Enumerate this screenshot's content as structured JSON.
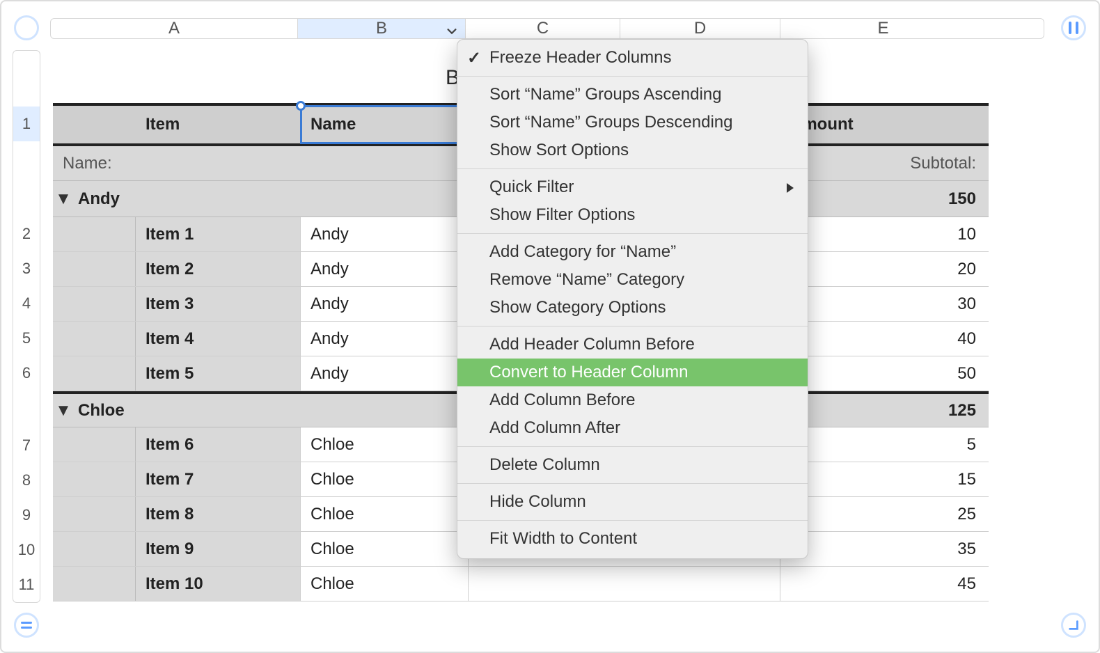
{
  "title_visible": "B",
  "columns": {
    "A": "A",
    "B": "B",
    "C": "C",
    "D": "D",
    "E": "E"
  },
  "rowNumbers": [
    "1",
    "2",
    "3",
    "4",
    "5",
    "6",
    "7",
    "8",
    "9",
    "10",
    "11"
  ],
  "header": {
    "item": "Item",
    "name": "Name",
    "amount": "Amount"
  },
  "groupLabel": {
    "name": "Name:",
    "subtotal": "Subtotal:"
  },
  "groups": [
    {
      "name": "Andy",
      "subtotal": "150",
      "rows": [
        {
          "item": "Item 1",
          "name": "Andy",
          "amount": "10"
        },
        {
          "item": "Item 2",
          "name": "Andy",
          "amount": "20"
        },
        {
          "item": "Item 3",
          "name": "Andy",
          "amount": "30"
        },
        {
          "item": "Item 4",
          "name": "Andy",
          "amount": "40"
        },
        {
          "item": "Item 5",
          "name": "Andy",
          "amount": "50"
        }
      ]
    },
    {
      "name": "Chloe",
      "subtotal": "125",
      "rows": [
        {
          "item": "Item 6",
          "name": "Chloe",
          "amount": "5"
        },
        {
          "item": "Item 7",
          "name": "Chloe",
          "amount": "15"
        },
        {
          "item": "Item 8",
          "name": "Chloe",
          "amount": "25"
        },
        {
          "item": "Item 9",
          "name": "Chloe",
          "amount": "35"
        },
        {
          "item": "Item 10",
          "name": "Chloe",
          "amount": "45"
        }
      ]
    }
  ],
  "menu": {
    "freeze": "Freeze Header Columns",
    "sortAsc": "Sort “Name” Groups Ascending",
    "sortDesc": "Sort “Name” Groups Descending",
    "sortOpt": "Show Sort Options",
    "quickFilter": "Quick Filter",
    "filterOpt": "Show Filter Options",
    "addCat": "Add Category for “Name”",
    "removeCat": "Remove “Name” Category",
    "catOpt": "Show Category Options",
    "addHdrBefore": "Add Header Column Before",
    "convertHdr": "Convert to Header Column",
    "addBefore": "Add Column Before",
    "addAfter": "Add Column After",
    "delete": "Delete Column",
    "hide": "Hide Column",
    "fit": "Fit Width to Content"
  }
}
